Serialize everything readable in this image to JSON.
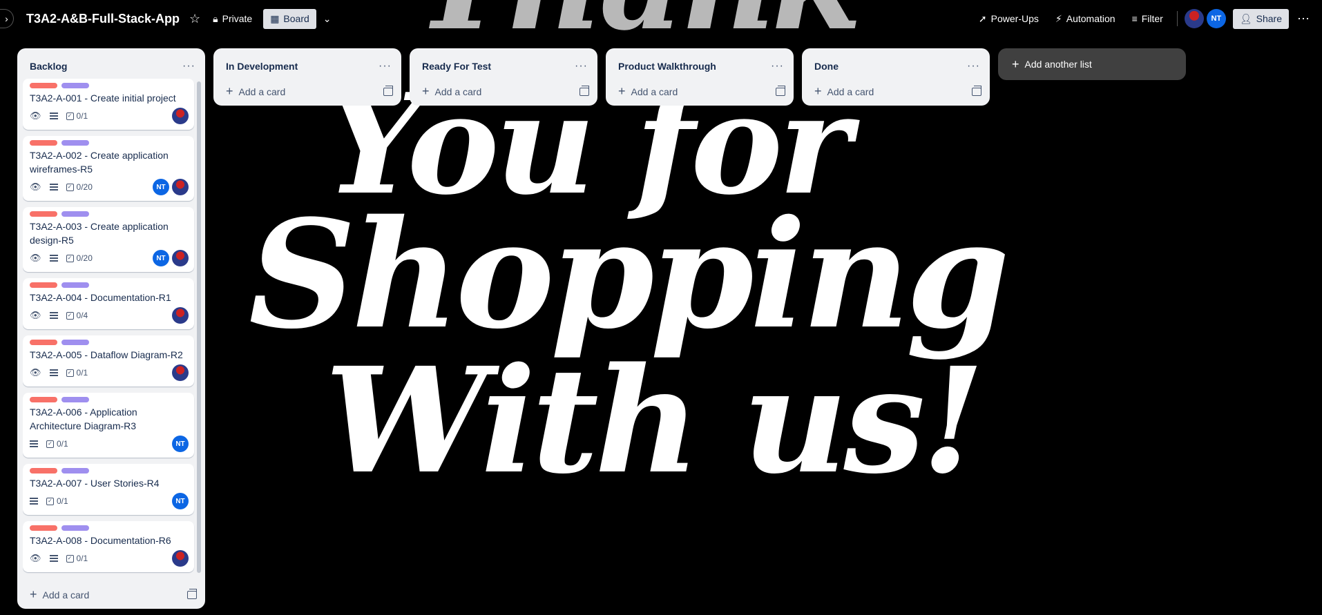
{
  "header": {
    "toggle_icon": "›",
    "board_title": "T3A2-A&B-Full-Stack-App",
    "star_icon": "☆",
    "visibility_label": "Private",
    "view_label": "Board",
    "chevron": "⌄",
    "powerups_label": "Power-Ups",
    "automation_label": "Automation",
    "filter_label": "Filter",
    "member_initials": "NT",
    "share_label": "Share",
    "more": "⋯"
  },
  "background": {
    "line1": "Thank",
    "line2": "You for",
    "line3": "Shopping",
    "line4": "With us!"
  },
  "lists": {
    "backlog": {
      "title": "Backlog",
      "menu": "···",
      "add_card": "Add a card",
      "cards": [
        {
          "title": "T3A2-A-001 - Create initial project",
          "checklist": "0/1",
          "members": [
            "photo"
          ],
          "watch": true,
          "description": true
        },
        {
          "title": "T3A2-A-002 - Create application wireframes-R5",
          "checklist": "0/20",
          "members": [
            "NT",
            "photo"
          ],
          "watch": true,
          "description": true
        },
        {
          "title": "T3A2-A-003 - Create application design-R5",
          "checklist": "0/20",
          "members": [
            "NT",
            "photo"
          ],
          "watch": true,
          "description": true
        },
        {
          "title": "T3A2-A-004 - Documentation-R1",
          "checklist": "0/4",
          "members": [
            "photo"
          ],
          "watch": true,
          "description": true
        },
        {
          "title": "T3A2-A-005 - Dataflow Diagram-R2",
          "checklist": "0/1",
          "members": [
            "photo"
          ],
          "watch": true,
          "description": true
        },
        {
          "title": "T3A2-A-006 - Application Architecture Diagram-R3",
          "checklist": "0/1",
          "members": [
            "NT"
          ],
          "watch": false,
          "description": true
        },
        {
          "title": "T3A2-A-007 - User Stories-R4",
          "checklist": "0/1",
          "members": [
            "NT"
          ],
          "watch": false,
          "description": true
        },
        {
          "title": "T3A2-A-008 - Documentation-R6",
          "checklist": "0/1",
          "members": [
            "photo"
          ],
          "watch": true,
          "description": true
        }
      ]
    },
    "in_development": {
      "title": "In Development",
      "menu": "···",
      "add_card": "Add a card"
    },
    "ready_for_test": {
      "title": "Ready For Test",
      "menu": "···",
      "add_card": "Add a card"
    },
    "product_walkthrough": {
      "title": "Product Walkthrough",
      "menu": "···",
      "add_card": "Add a card"
    },
    "done": {
      "title": "Done",
      "menu": "···",
      "add_card": "Add a card"
    },
    "add_another_list": "Add another list"
  },
  "colors": {
    "label_red": "#f87168",
    "label_purple": "#9f8fef",
    "member_blue": "#0c66e4",
    "list_bg": "#f1f2f4"
  }
}
